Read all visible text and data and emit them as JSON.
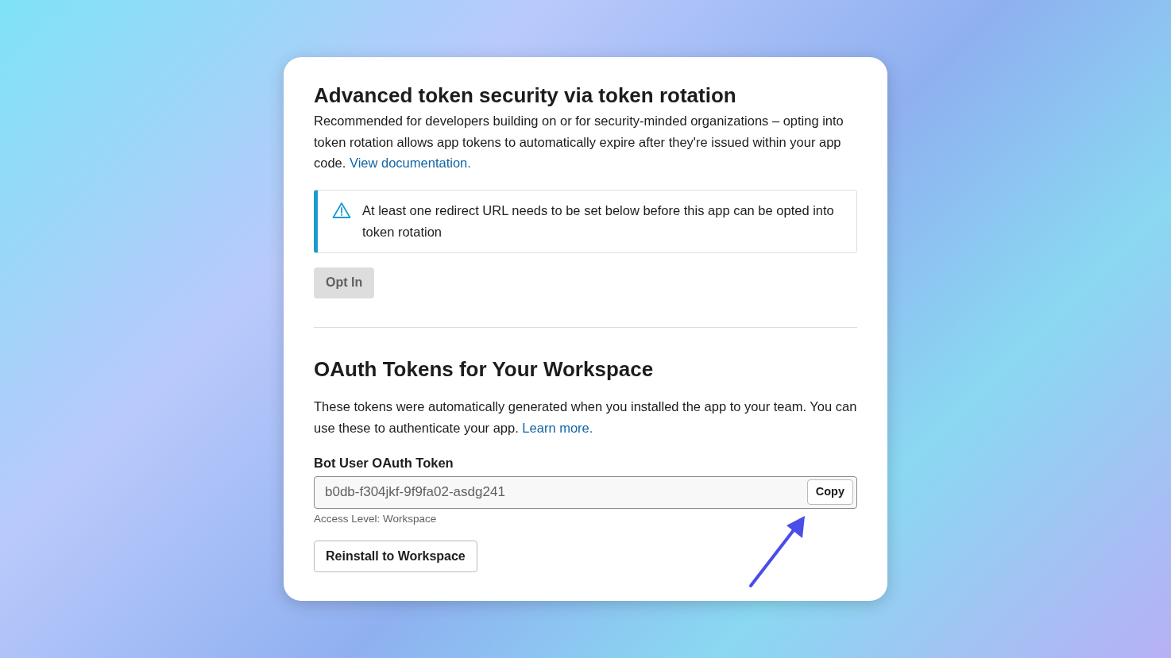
{
  "rotation": {
    "title": "Advanced token security via token rotation",
    "description": "Recommended for developers building on or for security-minded organizations – opting into token rotation allows app tokens to automatically expire after they're issued within your app code.",
    "link": "View documentation.",
    "notice": "At least one redirect URL needs to be set below before this app can be opted into token rotation",
    "button": {
      "label": "Opt In",
      "disabled": true
    }
  },
  "oauth": {
    "title": "OAuth Tokens for Your Workspace",
    "description": "These tokens were automatically generated when you installed the app to your team. You can use these to authenticate your app.",
    "link": "Learn more.",
    "field_label": "Bot User OAuth Token",
    "token": "b0db-f304jkf-9f9fa02-asdg241",
    "copy_button": "Copy",
    "access_level": "Access Level: Workspace",
    "reinstall_button": "Reinstall to Workspace"
  }
}
